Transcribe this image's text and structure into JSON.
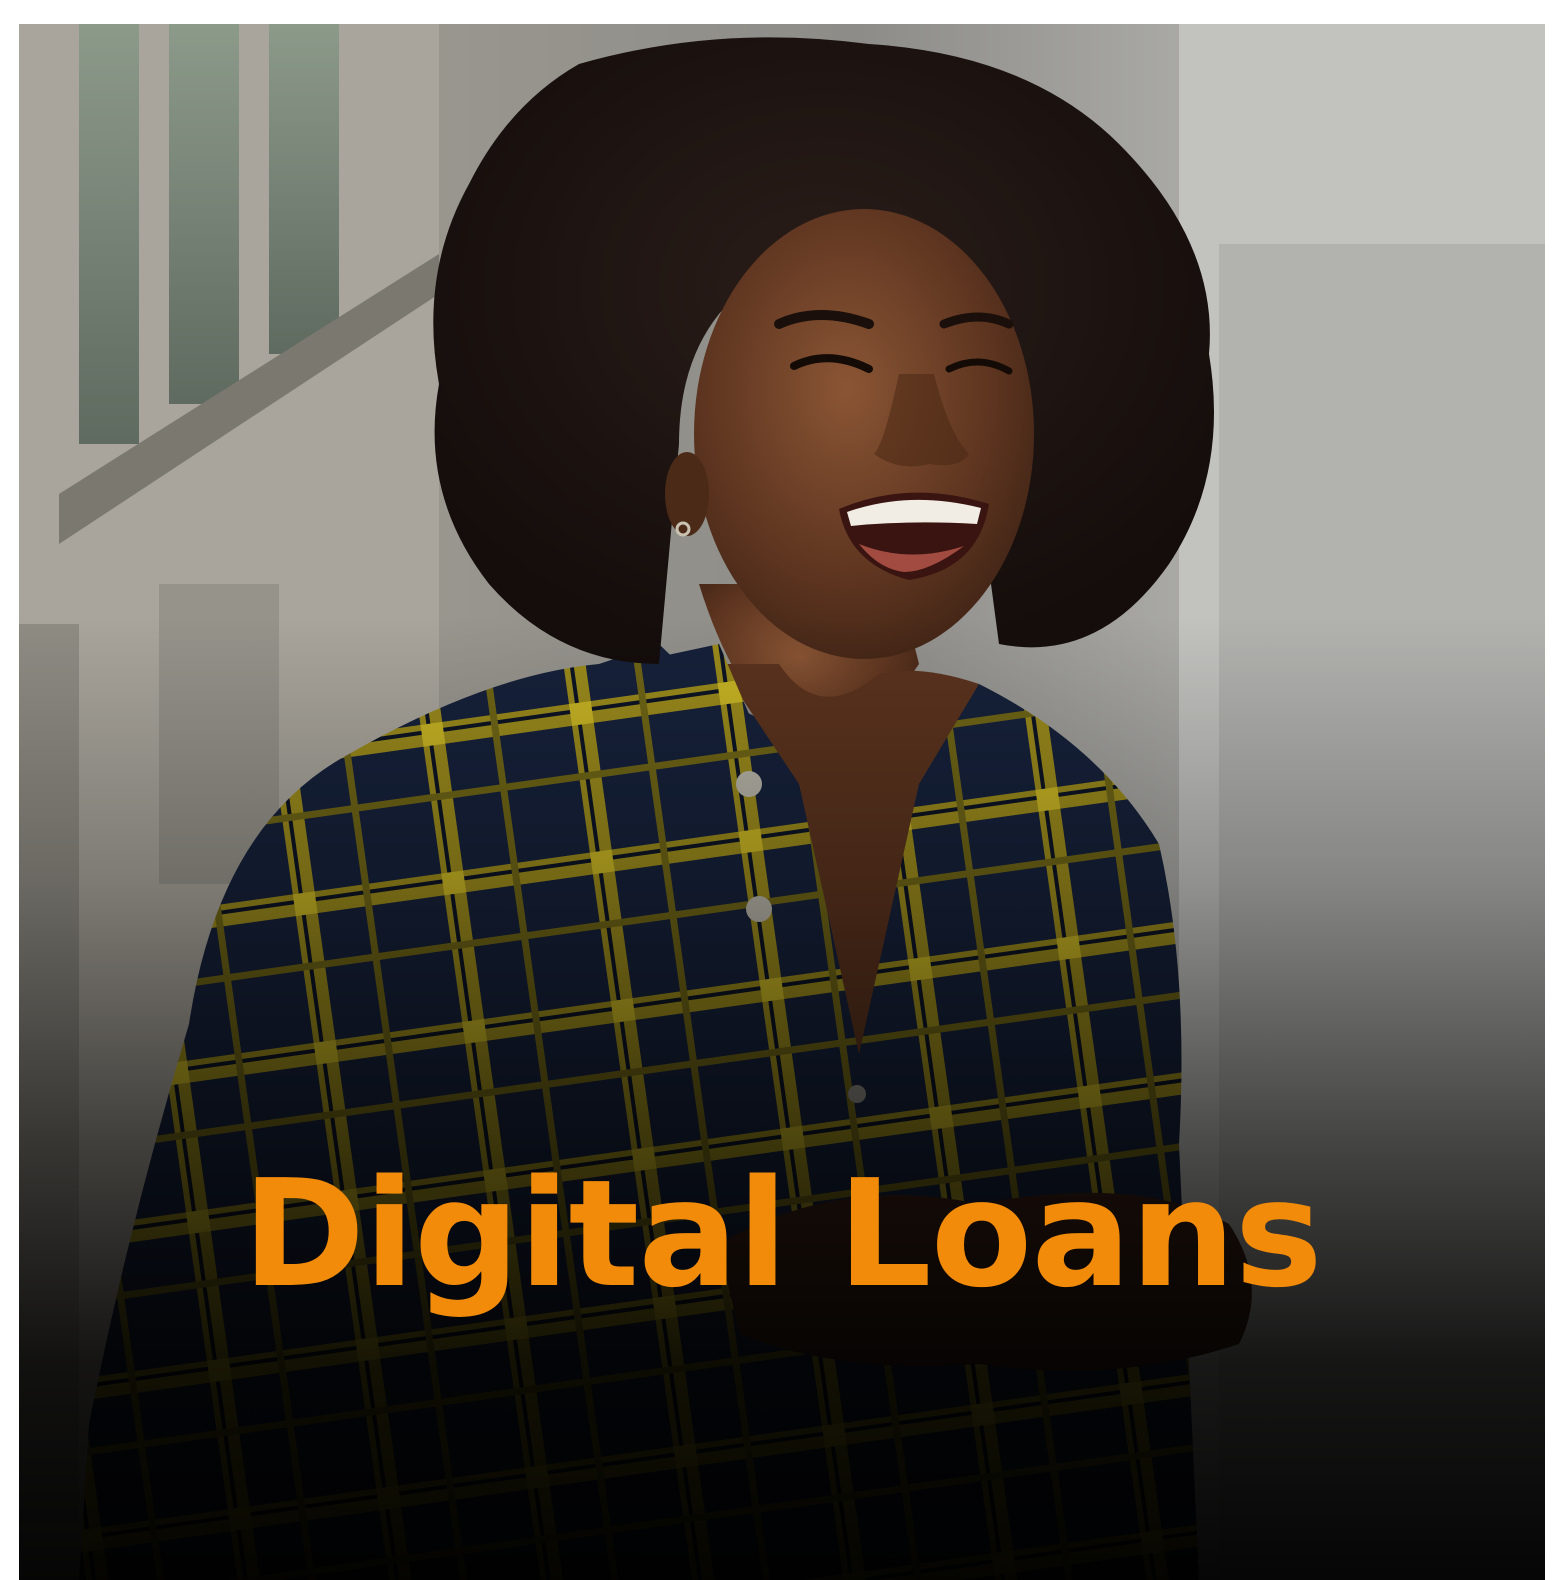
{
  "card": {
    "title": "Digital Loans",
    "title_color": "#f28a0a"
  },
  "photo": {
    "subject": "woman-smiling-plaid-shirt"
  }
}
